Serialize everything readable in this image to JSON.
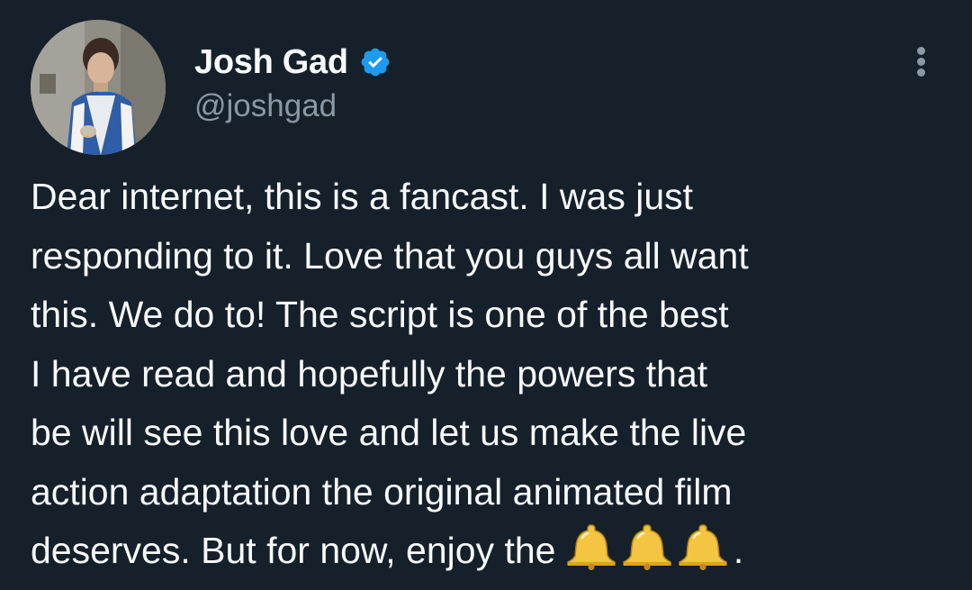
{
  "author": {
    "display_name": "Josh Gad",
    "handle": "@joshgad",
    "verified": true,
    "avatar_icon": "profile-photo-child-in-blue-jacket"
  },
  "tweet": {
    "lines": [
      "Dear internet, this is a fancast. I was just",
      "responding to it. Love that you guys all want",
      "this. We do to! The script is one of the best",
      "I have read and hopefully the powers that",
      "be will see this love and let us make the live",
      "action adaptation the original animated film",
      "deserves. But for now, enjoy the "
    ],
    "emoji": [
      "🔔",
      "🔔",
      "🔔"
    ],
    "trailing": "."
  },
  "menu": {
    "icon": "more-vertical-icon"
  },
  "colors": {
    "background": "#15202b",
    "text": "#f7f9f9",
    "secondary_text": "#8b98a5",
    "verified_badge": "#1d9bf0",
    "bell": "#f4c542"
  }
}
